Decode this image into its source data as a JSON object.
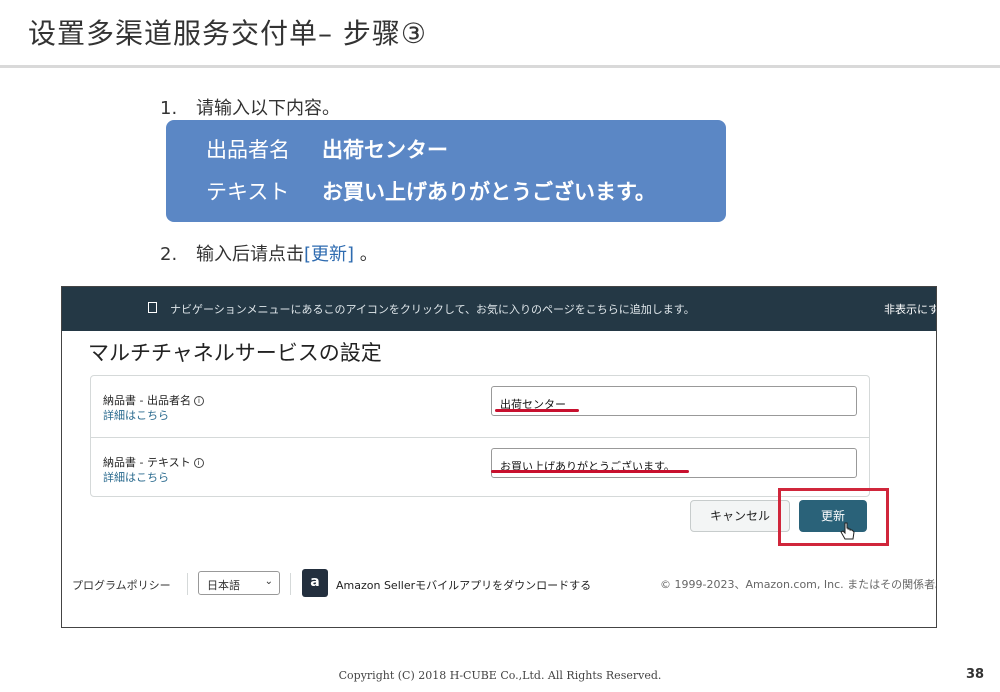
{
  "slide": {
    "title": "设置多渠道服务交付单– 步骤③",
    "step1_num": "1.",
    "step1_text": "请输入以下内容。",
    "box": {
      "row1_key": "出品者名",
      "row1_value": "出荷センター",
      "row2_key": "テキスト",
      "row2_value": "お買い上げありがとうございます。"
    },
    "step2_num": "2.",
    "step2_prefix": "输入后请点击",
    "step2_link": "[更新]",
    "step2_suffix": " 。",
    "copyright": "Copyright (C) 2018 H-CUBE Co.,Ltd. All Rights Reserved.",
    "page_number": "38"
  },
  "screenshot": {
    "navbar_message": "ナビゲーションメニューにあるこのアイコンをクリックして、お気に入りのページをこちらに追加します。",
    "navbar_hide": "非表示にす",
    "page_title": "マルチチャネルサービスの設定",
    "rows": [
      {
        "label": "納品書 - 出品者名",
        "info": "i",
        "details_link": "詳細はこちら",
        "value": "出荷センター"
      },
      {
        "label": "納品書 - テキスト",
        "info": "i",
        "details_link": "詳細はこちら",
        "value": "お買い上げありがとうございます。"
      }
    ],
    "cancel_button": "キャンセル",
    "update_button": "更新",
    "footer": {
      "policy": "プログラムポリシー",
      "language": "日本語",
      "app_icon_letter": "a",
      "app_text": "Amazon Sellerモバイルアプリをダウンロードする",
      "copyright": "© 1999-2023、Amazon.com, Inc. またはその関係者。"
    }
  },
  "colors": {
    "blue_box": "#5b87c5",
    "navbar": "#243845",
    "update_button": "#2a6279",
    "highlight_red": "#d0263b"
  }
}
